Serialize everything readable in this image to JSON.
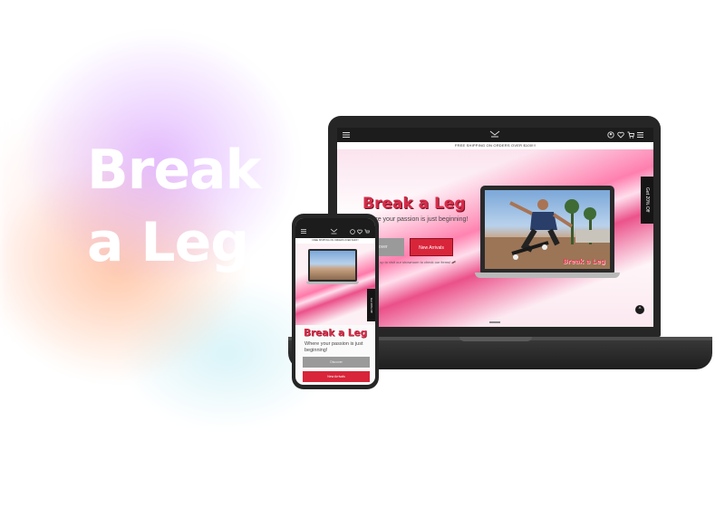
{
  "headline": {
    "line1": "Break",
    "line2": "a Leg"
  },
  "laptop": {
    "banner": "FREE SHIPPING ON ORDERS OVER $100!!!",
    "hero_title": "Break a Leg",
    "hero_subtitle": "Where your passion is just beginning!",
    "button_gray": "Discover",
    "button_red": "New Arrivals",
    "note": "Sign up to visit our showroom to check our items! 🛹",
    "side_tab": "Get 20% Off",
    "mini_logo": "Break a Leg",
    "scroll_top_icon": "^"
  },
  "phone": {
    "banner": "FREE SHIPPING ON ORDERS OVER $100!!!",
    "title": "Break a Leg",
    "subtitle": "Where your passion is just beginning!",
    "button_gray": "Discover",
    "button_red": "New Arrivals",
    "side_tab": "Get 20% Off"
  },
  "icons": [
    "menu-icon",
    "logo-icon",
    "user-icon",
    "heart-icon",
    "cart-icon",
    "hamburger-icon",
    "chevron-up-icon"
  ],
  "colors": {
    "brand_red": "#d62d4a",
    "dark": "#262626",
    "gray_button": "#9a9a9a"
  }
}
